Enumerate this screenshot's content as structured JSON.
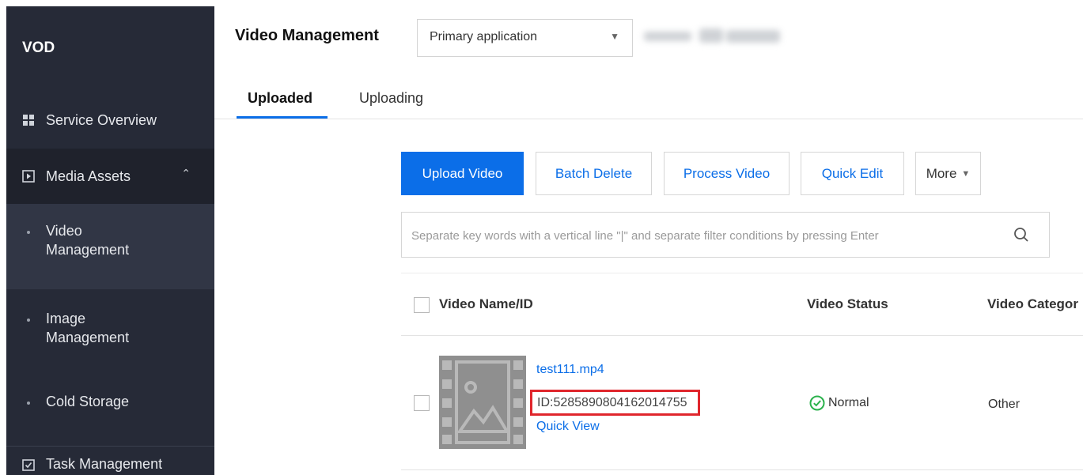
{
  "sidebar": {
    "brand": "VOD",
    "service_overview": "Service Overview",
    "media_assets": "Media Assets",
    "video_management_line1": "Video",
    "video_management_line2": "Management",
    "image_management_line1": "Image",
    "image_management_line2": "Management",
    "cold_storage": "Cold Storage",
    "task_management": "Task Management"
  },
  "header": {
    "title": "Video Management",
    "app_select": "Primary application"
  },
  "tabs": [
    "Uploaded",
    "Uploading"
  ],
  "toolbar": {
    "upload": "Upload Video",
    "batch_delete": "Batch Delete",
    "process": "Process Video",
    "quick_edit": "Quick Edit",
    "more": "More"
  },
  "search": {
    "placeholder": "Separate key words with a vertical line \"|\" and separate filter conditions by pressing Enter"
  },
  "table": {
    "columns": [
      "Video Name/ID",
      "Video Status",
      "Video Categor"
    ],
    "rows": [
      {
        "name": "test111.mp4",
        "id": "ID:5285890804162014755",
        "action": "Quick View",
        "status": "Normal",
        "category": "Other"
      }
    ]
  },
  "colors": {
    "accent": "#0b6ee8",
    "sidebar_bg": "#262a37",
    "highlight_box": "#e0262c",
    "status_ok": "#2bb24c"
  }
}
